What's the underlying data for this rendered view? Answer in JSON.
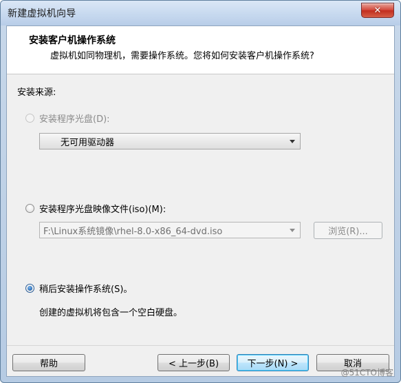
{
  "window": {
    "title": "新建虚拟机向导",
    "close_glyph": "✕"
  },
  "header": {
    "title": "安装客户机操作系统",
    "description": "虚拟机如同物理机，需要操作系统。您将如何安装客户机操作系统?"
  },
  "install_source": {
    "label": "安装来源:",
    "options": [
      {
        "label": "安装程序光盘(D):",
        "selected": false,
        "enabled": false,
        "dropdown_value": "无可用驱动器"
      },
      {
        "label": "安装程序光盘映像文件(iso)(M):",
        "selected": false,
        "enabled": true,
        "path_value": "F:\\Linux系统镜像\\rhel-8.0-x86_64-dvd.iso",
        "browse_label": "浏览(R)..."
      },
      {
        "label": "稍后安装操作系统(S)。",
        "selected": true,
        "enabled": true,
        "note": "创建的虚拟机将包含一个空白硬盘。"
      }
    ]
  },
  "buttons": {
    "help": "帮助",
    "back": "< 上一步(B)",
    "next": "下一步(N) >",
    "cancel": "取消"
  },
  "watermark": "@51CTO博客",
  "colors": {
    "accent": "#2a6bb4",
    "close_button": "#c12d1e",
    "default_button": "#a7d9f5"
  }
}
